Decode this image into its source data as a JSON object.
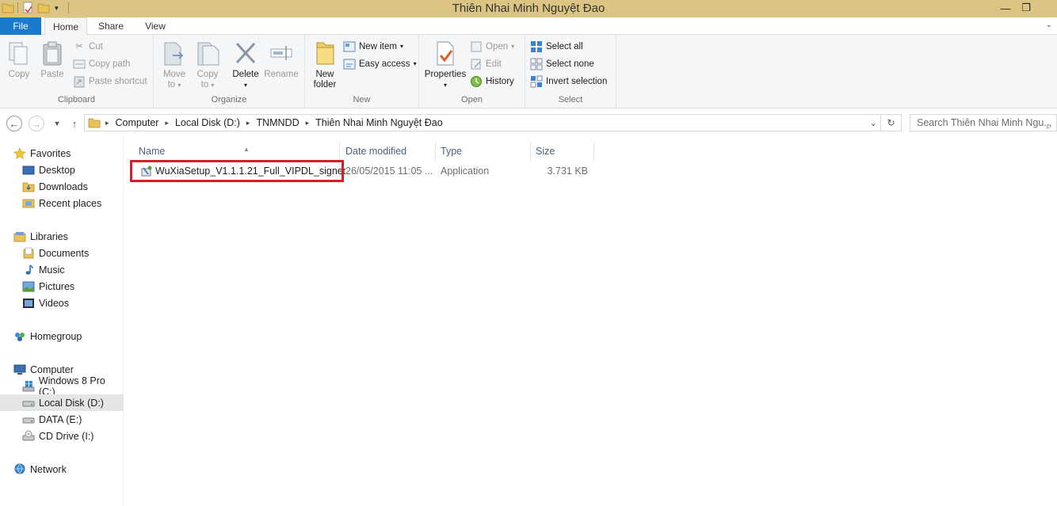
{
  "window": {
    "title": "Thiên Nhai Minh Nguyệt Đao",
    "minimize": "—",
    "maximize": "❐"
  },
  "tabs": {
    "file": "File",
    "home": "Home",
    "share": "Share",
    "view": "View"
  },
  "ribbon": {
    "clipboard": {
      "label": "Clipboard",
      "copy": "Copy",
      "paste": "Paste",
      "cut": "Cut",
      "copy_path": "Copy path",
      "paste_shortcut": "Paste shortcut"
    },
    "organize": {
      "label": "Organize",
      "move_to": "Move",
      "move_to2": "to",
      "copy_to": "Copy",
      "copy_to2": "to",
      "delete": "Delete",
      "rename": "Rename"
    },
    "new": {
      "label": "New",
      "new_folder": "New",
      "new_folder2": "folder",
      "new_item": "New item",
      "easy_access": "Easy access"
    },
    "open": {
      "label": "Open",
      "properties": "Properties",
      "open": "Open",
      "edit": "Edit",
      "history": "History"
    },
    "select": {
      "label": "Select",
      "select_all": "Select all",
      "select_none": "Select none",
      "invert_selection": "Invert selection"
    }
  },
  "address": {
    "crumbs": [
      "Computer",
      "Local Disk (D:)",
      "TNMNDD",
      "Thiên Nhai Minh Nguyệt Đao"
    ],
    "search_placeholder": "Search Thiên Nhai Minh Ngu..."
  },
  "nav": {
    "favorites": "Favorites",
    "desktop": "Desktop",
    "downloads": "Downloads",
    "recent": "Recent places",
    "libraries": "Libraries",
    "documents": "Documents",
    "music": "Music",
    "pictures": "Pictures",
    "videos": "Videos",
    "homegroup": "Homegroup",
    "computer": "Computer",
    "drive_c": "Windows 8 Pro (C:)",
    "drive_d": "Local Disk (D:)",
    "drive_e": "DATA (E:)",
    "drive_i": "CD Drive (I:)",
    "network": "Network"
  },
  "columns": {
    "name": "Name",
    "date": "Date modified",
    "type": "Type",
    "size": "Size"
  },
  "files": [
    {
      "name": "WuXiaSetup_V1.1.1.21_Full_VIPDL_signed...",
      "date": "26/05/2015 11:05 ...",
      "type": "Application",
      "size": "3.731 KB"
    }
  ],
  "colors": {
    "titlebar": "#dcc583",
    "file_tab": "#1979ca",
    "highlight": "#d41f26"
  }
}
